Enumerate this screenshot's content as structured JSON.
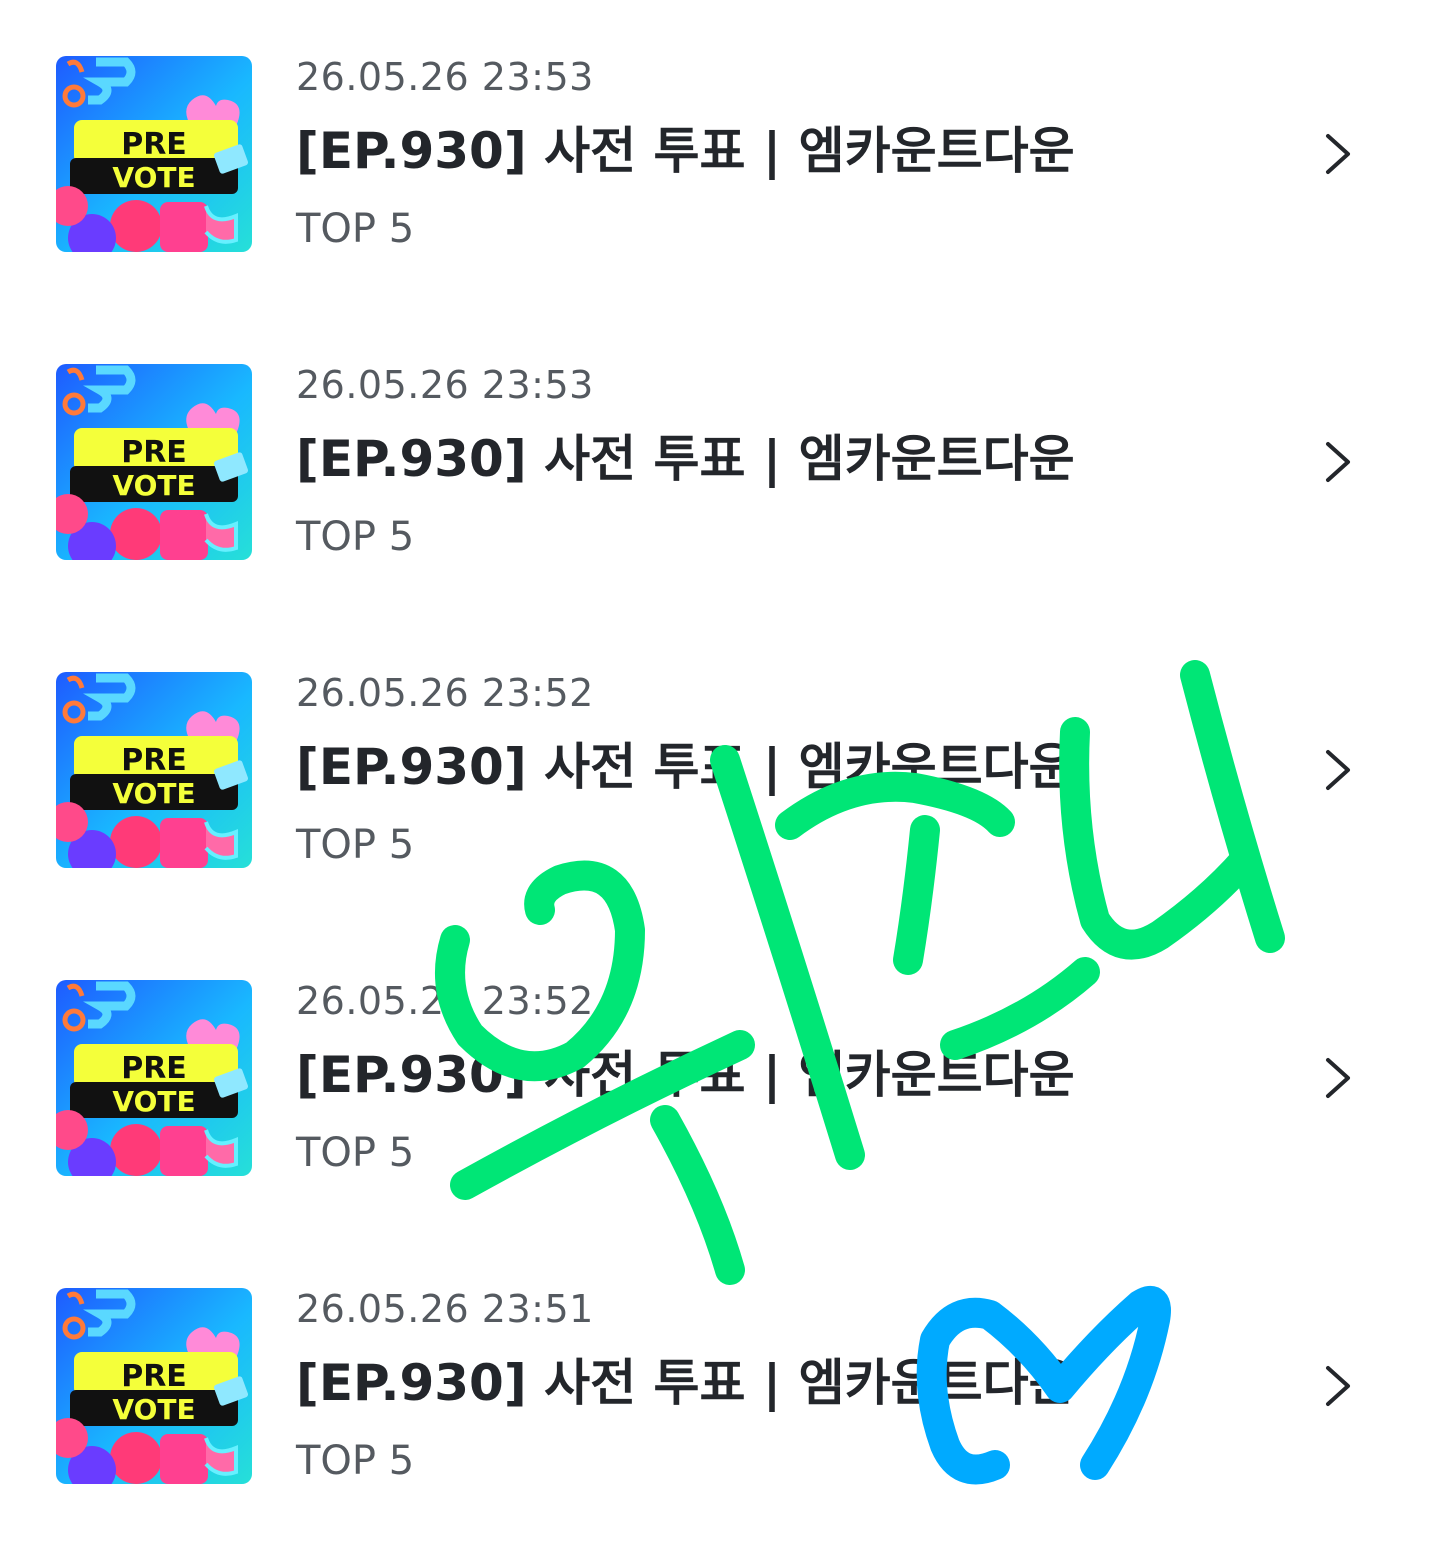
{
  "colors": {
    "title": "#23262b",
    "meta": "#555a60",
    "scribble_green": "#00e676",
    "scribble_blue": "#00aaff"
  },
  "thumbnail": {
    "line1": "PRE",
    "line2": "VOTE"
  },
  "items": [
    {
      "date": "26.05.26 23:53",
      "title": "[EP.930] 사전 투표 | 엠카운트다운",
      "subtitle": "TOP 5"
    },
    {
      "date": "26.05.26 23:53",
      "title": "[EP.930] 사전 투표 | 엠카운트다운",
      "subtitle": "TOP 5"
    },
    {
      "date": "26.05.26 23:52",
      "title": "[EP.930] 사전 투표 | 엠카운트다운",
      "subtitle": "TOP 5"
    },
    {
      "date": "26.05.26 23:52",
      "title": "[EP.930] 사전 투표 | 엠카운트다운",
      "subtitle": "TOP 5"
    },
    {
      "date": "26.05.26 23:51",
      "title": "[EP.930] 사전 투표 | 엠카운트다운",
      "subtitle": "TOP 5"
    }
  ]
}
